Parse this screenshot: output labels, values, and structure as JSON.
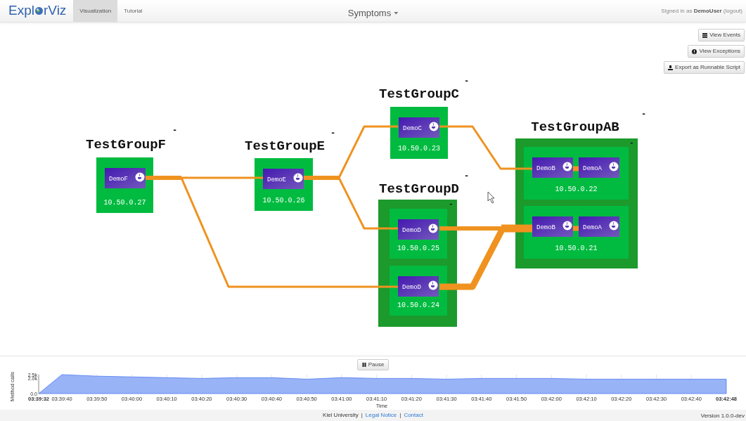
{
  "navbar": {
    "brand_start": "Expl",
    "brand_end": "rViz",
    "tabs": [
      {
        "label": "Visualization",
        "selected": true
      },
      {
        "label": "Tutorial",
        "selected": false
      }
    ],
    "title": "Symptoms",
    "user_text": "Signed in as **DemoUser** (logout)"
  },
  "actions": [
    {
      "kind": "list",
      "label": "View Events"
    },
    {
      "kind": "alert",
      "label": "View Exceptions"
    },
    {
      "kind": "export",
      "label": "Export as Runnable Script"
    }
  ],
  "landscape": {
    "systems": [
      {
        "name": "TestGroupF",
        "collapse": "-",
        "node_groups": [
          {
            "nodes": [
              {
                "ip": "10.50.0.27",
                "applications": [
                  {
                    "name": "DemoF"
                  }
                ]
              }
            ]
          }
        ]
      },
      {
        "name": "TestGroupE",
        "collapse": "-",
        "node_groups": [
          {
            "nodes": [
              {
                "ip": "10.50.0.26",
                "applications": [
                  {
                    "name": "DemoE"
                  }
                ]
              }
            ]
          }
        ]
      },
      {
        "name": "TestGroupC",
        "collapse": "-",
        "node_groups": [
          {
            "nodes": [
              {
                "ip": "10.50.0.23",
                "applications": [
                  {
                    "name": "DemoC"
                  }
                ]
              }
            ]
          }
        ]
      },
      {
        "name": "TestGroupD",
        "collapse": "-",
        "node_groups": [
          {
            "collapse": "-",
            "nodes": [
              {
                "ip": "10.50.0.25",
                "applications": [
                  {
                    "name": "DemoD"
                  }
                ]
              },
              {
                "ip": "10.50.0.24",
                "applications": [
                  {
                    "name": "DemoD"
                  }
                ]
              }
            ]
          }
        ]
      },
      {
        "name": "TestGroupAB",
        "collapse": "-",
        "node_groups": [
          {
            "collapse": "-",
            "nodes": [
              {
                "ip": "10.50.0.22",
                "applications": [
                  {
                    "name": "DemoB"
                  },
                  {
                    "name": "DemoA"
                  }
                ]
              },
              {
                "ip": "10.50.0.21",
                "applications": [
                  {
                    "name": "DemoB"
                  },
                  {
                    "name": "DemoA"
                  }
                ]
              }
            ]
          }
        ]
      }
    ]
  },
  "timeline": {
    "pause_label": "Pause",
    "chart_data": {
      "type": "area",
      "xlabel": "Time",
      "ylabel": "Method calls",
      "categories": [
        "03:39:32",
        "03:39:40",
        "03:39:50",
        "03:40:00",
        "03:40:10",
        "03:40:20",
        "03:40:30",
        "03:40:40",
        "03:40:50",
        "03:41:00",
        "03:41:10",
        "03:41:20",
        "03:41:30",
        "03:41:40",
        "03:41:50",
        "03:42:00",
        "03:42:10",
        "03:42:20",
        "03:42:30",
        "03:42:40",
        "03:42:48"
      ],
      "values": [
        0,
        2500,
        2300,
        2200,
        2100,
        2000,
        2100,
        2100,
        1900,
        2100,
        2000,
        2000,
        1900,
        2000,
        2000,
        2000,
        1900,
        1900,
        1900,
        1900,
        1900
      ],
      "grid": true,
      "ylim": [
        0,
        2500
      ],
      "yticks": [
        {
          "value": 0,
          "label": "0.0"
        },
        {
          "value": 2000,
          "label": "2.0k"
        },
        {
          "value": 2500,
          "label": "2.5k"
        }
      ]
    }
  },
  "footer": {
    "items": [
      {
        "kind": "text",
        "text": "Kiel University"
      },
      {
        "kind": "separator",
        "text": "|"
      },
      {
        "kind": "link",
        "text": "Legal Notice"
      },
      {
        "kind": "separator",
        "text": "|"
      },
      {
        "kind": "link",
        "text": "Contact"
      }
    ],
    "version": "Version 1.0.0-dev"
  }
}
